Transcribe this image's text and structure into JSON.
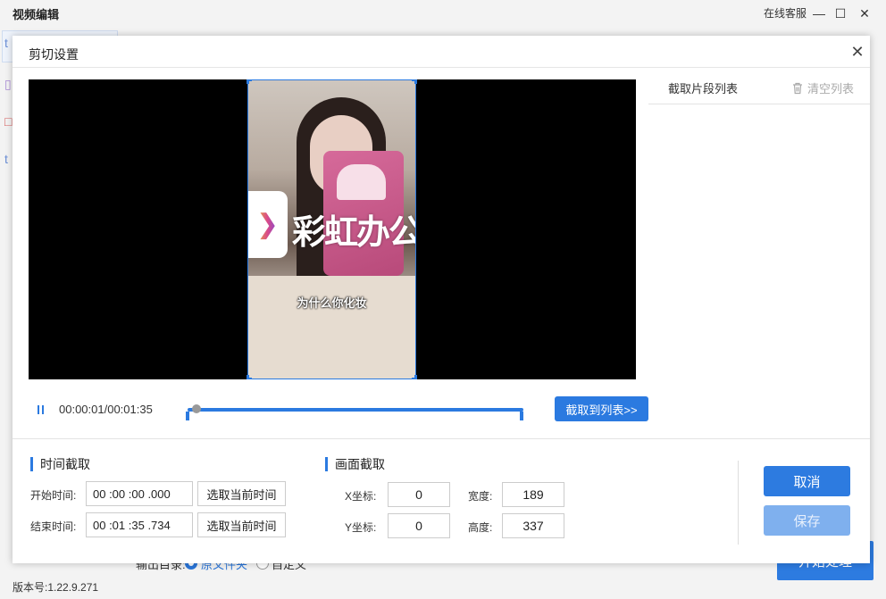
{
  "app": {
    "title": "视频编辑",
    "service_label": "在线客服",
    "version": "版本号:1.22.9.271",
    "output_label": "输出目录:",
    "output_option_original": "原文件夹",
    "output_option_custom": "自定义",
    "start_button": "开始处理"
  },
  "dialog": {
    "title": "剪切设置",
    "close_icon": "close-icon"
  },
  "video": {
    "watermark_text": "彩虹办公",
    "subtitle_text": "为什么你化妆"
  },
  "clip_list": {
    "title": "截取片段列表",
    "clear_label": "清空列表"
  },
  "player": {
    "time_readout": "00:00:01/00:01:35",
    "progress": 0.01,
    "add_to_list_button": "截取到列表>>"
  },
  "time_section": {
    "title": "时间截取",
    "start_label": "开始时间:",
    "start_value": "00 :00 :00 .000",
    "end_label": "结束时间:",
    "end_value": "00 :01 :35 .734",
    "pick_current_label": "选取当前时间"
  },
  "frame_section": {
    "title": "画面截取",
    "x_label": "X坐标:",
    "x_value": "0",
    "y_label": "Y坐标:",
    "y_value": "0",
    "width_label": "宽度:",
    "width_value": "189",
    "height_label": "高度:",
    "height_value": "337"
  },
  "actions": {
    "cancel": "取消",
    "save": "保存"
  },
  "colors": {
    "accent": "#2b7ae0",
    "save_disabled": "#7fb0ee"
  }
}
